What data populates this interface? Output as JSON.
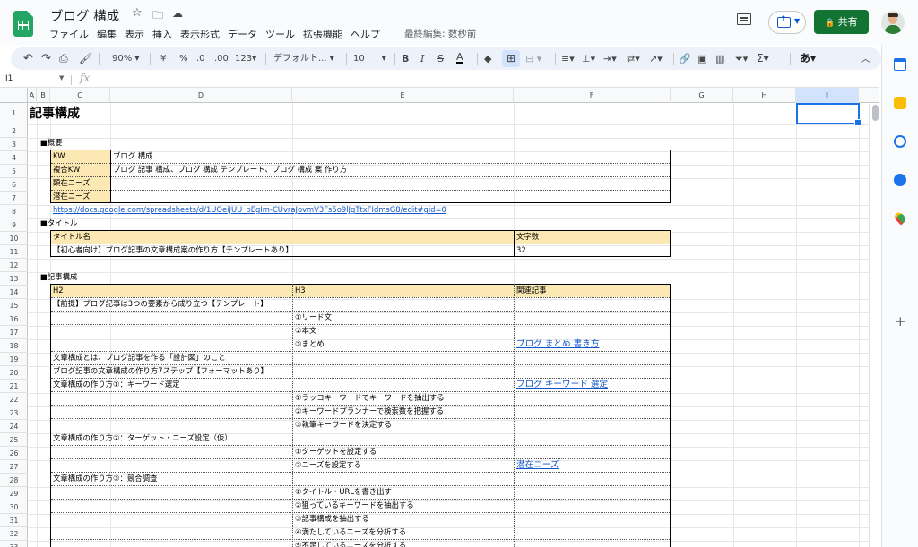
{
  "app": {
    "doc_title": "ブログ 構成",
    "last_edit": "最終編集: 数秒前",
    "share_label": "共有",
    "menu": [
      "ファイル",
      "編集",
      "表示",
      "挿入",
      "表示形式",
      "データ",
      "ツール",
      "拡張機能",
      "ヘルプ"
    ]
  },
  "toolbar": {
    "zoom": "90%",
    "currency": "¥",
    "percent": "%",
    "dec_decrease": ".0",
    "dec_increase": ".00",
    "number_format": "123",
    "font": "デフォルト...",
    "font_size": "10",
    "input_tools": "あ"
  },
  "formula_bar": {
    "cell_ref": "I1",
    "fx": "fx",
    "content": ""
  },
  "grid": {
    "columns": [
      "A",
      "B",
      "C",
      "D",
      "E",
      "F",
      "G",
      "H",
      "I"
    ],
    "selected_column": "I",
    "rows": [
      "1",
      "2",
      "3",
      "4",
      "5",
      "6",
      "7",
      "8",
      "9",
      "10",
      "11",
      "12",
      "13",
      "14",
      "15",
      "16",
      "17",
      "18",
      "19",
      "20",
      "21",
      "22",
      "23",
      "24",
      "25",
      "26",
      "27",
      "28",
      "29",
      "30",
      "31",
      "32",
      "33"
    ]
  },
  "sheet": {
    "title": "記事構成",
    "overview": {
      "section": "■概要",
      "rows": [
        {
          "label": "KW",
          "value": "ブログ 構成"
        },
        {
          "label": "複合KW",
          "value": "ブログ 記事 構成、ブログ 構成 テンプレート、ブログ 構成 案 作り方"
        },
        {
          "label": "顕在ニーズ",
          "value": ""
        },
        {
          "label": "潜在ニーズ",
          "value": ""
        }
      ],
      "url": "https://docs.google.com/spreadsheets/d/1UOeiJUU_bEgIm-CUvraJovmV3Fs5o9lJgTtxFIdmsG8/edit#gid=0"
    },
    "title_section": {
      "section": "■タイトル",
      "headers": {
        "name": "タイトル名",
        "count": "文字数"
      },
      "title_value": "【初心者向け】ブログ記事の文章構成案の作り方【テンプレートあり】",
      "count_value": "32"
    },
    "structure": {
      "section": "■記事構成",
      "headers": {
        "h2": "H2",
        "h3": "H3",
        "related": "関連記事"
      },
      "rows": [
        {
          "h2": "【前提】ブログ記事は3つの要素から成り立つ【テンプレート】",
          "h3": "",
          "related": ""
        },
        {
          "h2": "",
          "h3": "①リード文",
          "related": ""
        },
        {
          "h2": "",
          "h3": "②本文",
          "related": ""
        },
        {
          "h2": "",
          "h3": "③まとめ",
          "related": "ブログ まとめ 書き方"
        },
        {
          "h2": "文章構成とは、ブログ記事を作る「設計図」のこと",
          "h3": "",
          "related": ""
        },
        {
          "h2": "ブログ記事の文章構成の作り方7ステップ【フォーマットあり】",
          "h3": "",
          "related": ""
        },
        {
          "h2": "文章構成の作り方①：キーワード選定",
          "h3": "",
          "related": "ブログ キーワード 選定"
        },
        {
          "h2": "",
          "h3": "①ラッコキーワードでキーワードを抽出する",
          "related": ""
        },
        {
          "h2": "",
          "h3": "②キーワードプランナーで検索数を把握する",
          "related": ""
        },
        {
          "h2": "",
          "h3": "③執筆キーワードを決定する",
          "related": ""
        },
        {
          "h2": "文章構成の作り方②：ターゲット・ニーズ設定（仮）",
          "h3": "",
          "related": ""
        },
        {
          "h2": "",
          "h3": "①ターゲットを設定する",
          "related": ""
        },
        {
          "h2": "",
          "h3": "②ニーズを設定する",
          "related": "潜在ニーズ"
        },
        {
          "h2": "文章構成の作り方③：競合調査",
          "h3": "",
          "related": ""
        },
        {
          "h2": "",
          "h3": "①タイトル・URLを書き出す",
          "related": ""
        },
        {
          "h2": "",
          "h3": "②狙っているキーワードを抽出する",
          "related": ""
        },
        {
          "h2": "",
          "h3": "③記事構成を抽出する",
          "related": ""
        },
        {
          "h2": "",
          "h3": "④満たしているニーズを分析する",
          "related": ""
        },
        {
          "h2": "",
          "h3": "⑤不足しているニーズを分析する",
          "related": ""
        }
      ]
    }
  },
  "colors": {
    "accent_blue": "#1a73e8",
    "share_green": "#137333",
    "header_fill": "#fce8b2",
    "link": "#1155cc"
  },
  "icons": [
    "sheets-logo-icon",
    "star-icon",
    "move-folder-icon",
    "cloud-status-icon",
    "comment-icon",
    "present-icon",
    "lock-icon",
    "avatar",
    "undo-icon",
    "redo-icon",
    "print-icon",
    "paint-format-icon",
    "bold-icon",
    "italic-icon",
    "strikethrough-icon",
    "text-color-icon",
    "fill-color-icon",
    "borders-icon",
    "merge-icon",
    "align-icon",
    "valign-icon",
    "wrap-icon",
    "rotate-icon",
    "link-icon",
    "insert-comment-icon",
    "chart-icon",
    "filter-icon",
    "functions-icon",
    "collapse-icon",
    "calendar-icon",
    "keep-icon",
    "tasks-icon",
    "contacts-icon",
    "maps-icon",
    "add-icon"
  ]
}
